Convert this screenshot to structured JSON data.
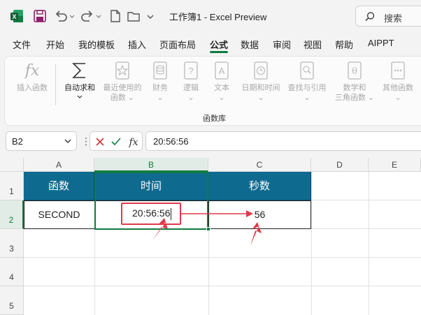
{
  "app": {
    "title": "工作簿1 - Excel Preview",
    "search_placeholder": "搜索"
  },
  "menu": [
    "文件",
    "开始",
    "我的模板",
    "插入",
    "页面布局",
    "公式",
    "数据",
    "审阅",
    "视图",
    "帮助",
    "AIPPT"
  ],
  "menu_active": "公式",
  "ribbon": {
    "buttons": [
      {
        "label": "插入函数",
        "icon": "fx-icon",
        "enabled": false
      },
      {
        "label": "自动求和",
        "icon": "sigma-icon",
        "enabled": true,
        "has_dropdown": true
      },
      {
        "label": "最近使用的函数",
        "line1": "最近使用的",
        "line2": "函数",
        "icon": "star-book-icon",
        "enabled": false
      },
      {
        "label": "财务",
        "icon": "coins-book-icon",
        "enabled": false
      },
      {
        "label": "逻辑",
        "icon": "question-book-icon",
        "enabled": false
      },
      {
        "label": "文本",
        "icon": "text-book-icon",
        "enabled": false
      },
      {
        "label": "日期和时间",
        "icon": "clock-book-icon",
        "enabled": false
      },
      {
        "label": "查找与引用",
        "icon": "search-book-icon",
        "enabled": false
      },
      {
        "label": "数学和三角函数",
        "line1": "数学和",
        "line2": "三角函数",
        "icon": "theta-book-icon",
        "enabled": false
      },
      {
        "label": "其他函数",
        "icon": "more-book-icon",
        "enabled": false
      }
    ],
    "group_label": "函数库"
  },
  "formula_bar": {
    "cell_ref": "B2",
    "formula": "20:56:56",
    "more_dots": "⋮"
  },
  "sheet": {
    "columns": [
      "A",
      "B",
      "C",
      "D",
      "E"
    ],
    "rows": [
      "1",
      "2",
      "3",
      "4",
      "5"
    ],
    "selected_cell": "B2",
    "header_row": [
      "函数",
      "时间",
      "秒数"
    ],
    "data_row": [
      "SECOND",
      "20:56:56",
      "56"
    ],
    "header_fill": "#0f6a8f",
    "accent": "#107c41",
    "annotation_color": "#e03a4a"
  }
}
